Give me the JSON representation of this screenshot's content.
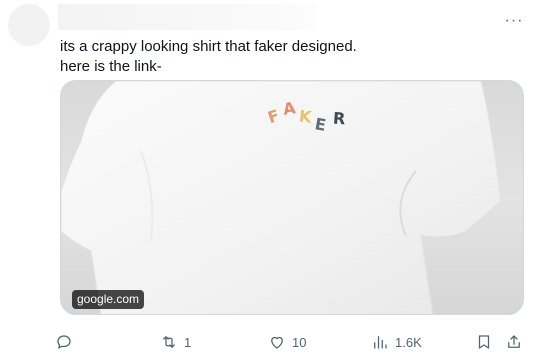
{
  "tweet": {
    "text_line1": "its a crappy looking shirt that faker designed.",
    "text_line2": "here is the link-",
    "more_label": "···"
  },
  "media": {
    "source": "google.com",
    "print_letters": [
      "F",
      "A",
      "K",
      "E",
      "R"
    ],
    "print_colors": [
      "#e89a6a",
      "#e58a6a",
      "#e8c36a",
      "#5a6f7a",
      "#3d4b57"
    ],
    "alt": "White t-shirt with FAKER print"
  },
  "actions": {
    "reply": {
      "icon": "reply-icon",
      "count": ""
    },
    "retweet": {
      "icon": "retweet-icon",
      "count": "1"
    },
    "like": {
      "icon": "heart-icon",
      "count": "10"
    },
    "views": {
      "icon": "views-icon",
      "count": "1.6K"
    },
    "bookmark": {
      "icon": "bookmark-icon"
    },
    "share": {
      "icon": "share-icon"
    }
  }
}
